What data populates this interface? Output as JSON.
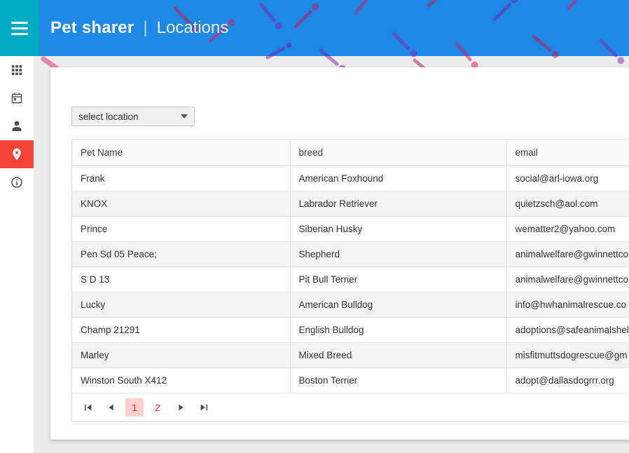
{
  "header": {
    "app_title": "Pet sharer",
    "separator": "|",
    "page_title": "Locations",
    "menu_icon": "hamburger-icon"
  },
  "colors": {
    "header_bar": "#1e88e5",
    "menu_square": "#00acc1",
    "sidebar_active": "#f44336",
    "active_page_bg": "#fbd0cd",
    "active_page_text": "#e53935"
  },
  "sidebar": {
    "items": [
      {
        "id": "apps",
        "icon": "grid-icon",
        "active": false
      },
      {
        "id": "calendar",
        "icon": "calendar-icon",
        "active": false
      },
      {
        "id": "people",
        "icon": "person-icon",
        "active": false
      },
      {
        "id": "locations",
        "icon": "place-pin-icon",
        "active": true
      },
      {
        "id": "about",
        "icon": "info-icon",
        "active": false
      }
    ]
  },
  "filter": {
    "selected_value": "select location",
    "caret_icon": "chevron-down-icon"
  },
  "table": {
    "columns": [
      "Pet Name",
      "breed",
      "email"
    ],
    "rows": [
      {
        "pet_name": "Frank",
        "breed": "American Foxhound",
        "email": "social@arl-iowa.org"
      },
      {
        "pet_name": "KNOX",
        "breed": "Labrador Retriever",
        "email": "quietzsch@aol.com"
      },
      {
        "pet_name": "Prince",
        "breed": "Siberian Husky",
        "email": "wematter2@yahoo.com"
      },
      {
        "pet_name": "Pen Sd 05 Peace;",
        "breed": "Shepherd",
        "email": "animalwelfare@gwinnettco"
      },
      {
        "pet_name": "S D 13",
        "breed": "Pit Bull Terrier",
        "email": "animalwelfare@gwinnettco"
      },
      {
        "pet_name": "Lucky",
        "breed": "American Bulldog",
        "email": "info@hwhanimalrescue.co"
      },
      {
        "pet_name": "Champ 21291",
        "breed": "English Bulldog",
        "email": "adoptions@safeanimalshel"
      },
      {
        "pet_name": "Marley",
        "breed": "Mixed Breed",
        "email": "misfitmuttsdogrescue@gm"
      },
      {
        "pet_name": "Winston South X412",
        "breed": "Boston Terrier",
        "email": "adopt@dallasdogrrr.org"
      }
    ]
  },
  "pagination": {
    "pages": [
      "1",
      "2"
    ],
    "active": "1",
    "controls": [
      "first-page-icon",
      "prev-page-icon",
      "next-page-icon",
      "last-page-icon"
    ]
  }
}
